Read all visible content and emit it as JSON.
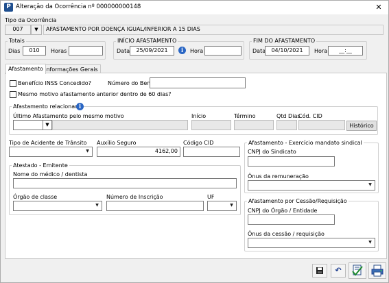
{
  "window": {
    "title": "Alteração da Ocorrência nº 000000000148"
  },
  "tipo_ocorrencia": {
    "label": "Tipo da Ocorrência",
    "code": "007",
    "description": "AFASTAMENTO POR DOENÇA IGUAL/INFERIOR A 15 DIAS"
  },
  "totais": {
    "title": "Totais",
    "dias_label": "Dias",
    "dias_value": "010",
    "horas_label": "Horas",
    "horas_value": ""
  },
  "inicio": {
    "title": "INÍCIO AFASTAMENTO",
    "data_label": "Data",
    "data_value": "25/09/2021",
    "hora_label": "Hora",
    "hora_value": ""
  },
  "fim": {
    "title": "FIM DO AFASTAMENTO",
    "data_label": "Data",
    "data_value": "04/10/2021",
    "hora_label": "Hora",
    "hora_value": "__:__"
  },
  "tabs": [
    {
      "label": "Afastamento"
    },
    {
      "label": "Informações Gerais"
    }
  ],
  "afastamento": {
    "inss_label": "Benefício INSS Concedido?",
    "num_beneficio_label": "Número do Benefício",
    "num_beneficio_value": "",
    "mesmo_motivo_label": "Mesmo motivo afastamento anterior dentro de 60 dias?",
    "relacionado": {
      "title": "Afastamento relacionado",
      "ultimo_label": "Último Afastamento pelo mesmo motivo",
      "inicio_label": "Início",
      "termino_label": "Término",
      "qtd_dias_label": "Qtd Dias",
      "cod_cid_label": "Cód. CID",
      "historico_button": "Histórico"
    },
    "tipo_acidente_label": "Tipo de Acidente de Trânsito",
    "auxilio_label": "Auxílio Seguro",
    "auxilio_value": "4162,00",
    "codigo_cid_label": "Código CID",
    "codigo_cid_value": "",
    "atestado": {
      "title": "Atestado - Emitente",
      "nome_label": "Nome do médico / dentista",
      "orgao_label": "Órgão de classe",
      "inscricao_label": "Número de Inscrição",
      "uf_label": "UF"
    },
    "sindical": {
      "title": "Afastamento - Exercício mandato sindical",
      "cnpj_label": "CNPJ do Sindicato",
      "onus_label": "Ônus da remuneração"
    },
    "cessao": {
      "title": "Afastamento por Cessão/Requisição",
      "cnpj_label": "CNPJ do Órgão / Entidade",
      "onus_label": "Ônus da cessão / requisição"
    }
  },
  "toolbar": [
    "save-icon",
    "undo-icon",
    "document-check-icon",
    "print-icon"
  ],
  "colors": {
    "info_icon": "#2a66c4",
    "app_icon": "#1f4f8f"
  }
}
